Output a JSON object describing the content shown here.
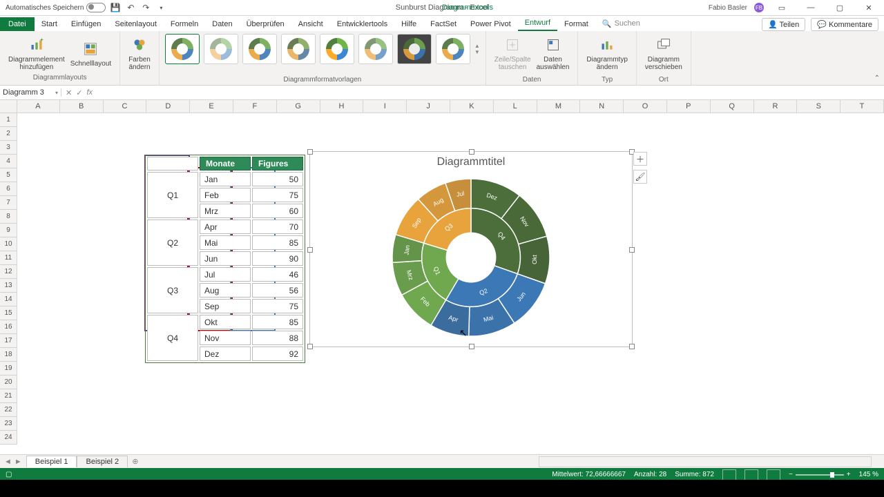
{
  "qat": {
    "autosave_label": "Automatisches Speichern"
  },
  "title": {
    "doc": "Sunburst Diagramm  -  Excel",
    "tool_tab": "Diagrammtools",
    "user": "Fabio Basler"
  },
  "tabs": {
    "file": "Datei",
    "items": [
      "Start",
      "Einfügen",
      "Seitenlayout",
      "Formeln",
      "Daten",
      "Überprüfen",
      "Ansicht",
      "Entwicklertools",
      "Hilfe",
      "FactSet",
      "Power Pivot",
      "Entwurf",
      "Format"
    ],
    "active": "Entwurf",
    "search_placeholder": "Suchen",
    "share": "Teilen",
    "comments": "Kommentare"
  },
  "ribbon": {
    "add_element": "Diagrammelement\nhinzufügen",
    "quick_layout": "Schnelllayout",
    "change_colors": "Farben\nändern",
    "group_layouts": "Diagrammlayouts",
    "group_styles": "Diagrammformatvorlagen",
    "switch_rowcol": "Zeile/Spalte\ntauschen",
    "select_data": "Daten\nauswählen",
    "group_data": "Daten",
    "change_type": "Diagrammtyp\nändern",
    "group_type": "Typ",
    "move_chart": "Diagramm\nverschieben",
    "group_location": "Ort"
  },
  "namebox": "Diagramm 3",
  "columns": [
    "A",
    "B",
    "C",
    "D",
    "E",
    "F",
    "G",
    "H",
    "I",
    "J",
    "K",
    "L",
    "M",
    "N",
    "O",
    "P",
    "Q",
    "R",
    "S",
    "T"
  ],
  "table": {
    "headers": [
      "",
      "Monate",
      "Figures"
    ],
    "quarters": [
      "Q1",
      "Q2",
      "Q3",
      "Q4"
    ],
    "rows": [
      [
        "Jan",
        50
      ],
      [
        "Feb",
        75
      ],
      [
        "Mrz",
        60
      ],
      [
        "Apr",
        70
      ],
      [
        "Mai",
        85
      ],
      [
        "Jun",
        90
      ],
      [
        "Jul",
        46
      ],
      [
        "Aug",
        56
      ],
      [
        "Sep",
        75
      ],
      [
        "Okt",
        85
      ],
      [
        "Nov",
        88
      ],
      [
        "Dez",
        92
      ]
    ]
  },
  "chart": {
    "title": "Diagrammtitel"
  },
  "chart_data": {
    "type": "pie",
    "title": "Diagrammtitel",
    "structure": "sunburst",
    "series": [
      {
        "name": "Q1",
        "color": "#6fa84f",
        "children": [
          {
            "name": "Jan",
            "value": 50
          },
          {
            "name": "Feb",
            "value": 75
          },
          {
            "name": "Mrz",
            "value": 60
          }
        ]
      },
      {
        "name": "Q2",
        "color": "#3b78b5",
        "children": [
          {
            "name": "Apr",
            "value": 70
          },
          {
            "name": "Mai",
            "value": 85
          },
          {
            "name": "Jun",
            "value": 90
          }
        ]
      },
      {
        "name": "Q3",
        "color": "#e8a33d",
        "children": [
          {
            "name": "Jul",
            "value": 46
          },
          {
            "name": "Aug",
            "value": 56
          },
          {
            "name": "Sep",
            "value": 75
          }
        ]
      },
      {
        "name": "Q4",
        "color": "#4b6e3a",
        "children": [
          {
            "name": "Okt",
            "value": 85
          },
          {
            "name": "Nov",
            "value": 88
          },
          {
            "name": "Dez",
            "value": 92
          }
        ]
      }
    ]
  },
  "sheets": {
    "active": "Beispiel 1",
    "other": "Beispiel 2"
  },
  "status": {
    "ready_icon": "■",
    "mean_label": "Mittelwert:",
    "mean": "72,66666667",
    "count_label": "Anzahl:",
    "count": "28",
    "sum_label": "Summe:",
    "sum": "872",
    "zoom": "145 %"
  }
}
